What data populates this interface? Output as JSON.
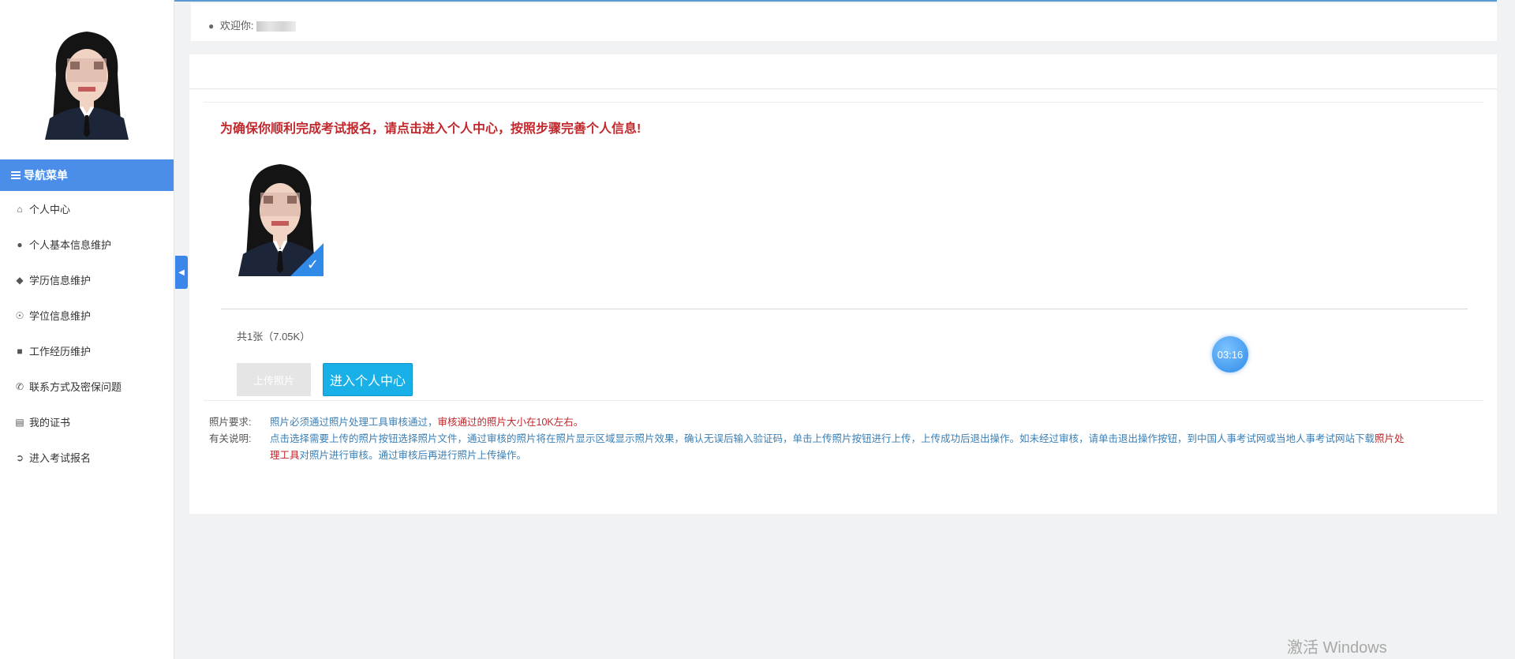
{
  "header": {
    "welcome_label": "欢迎你:",
    "user_name": ""
  },
  "sidebar": {
    "nav_title": "导航菜单",
    "items": [
      {
        "label": "个人中心",
        "icon": "home-icon"
      },
      {
        "label": "个人基本信息维护",
        "icon": "user-icon"
      },
      {
        "label": "学历信息维护",
        "icon": "graduation-cap-icon"
      },
      {
        "label": "学位信息维护",
        "icon": "medal-icon"
      },
      {
        "label": "工作经历维护",
        "icon": "briefcase-icon"
      },
      {
        "label": "联系方式及密保问题",
        "icon": "phone-icon"
      },
      {
        "label": "我的证书",
        "icon": "book-icon"
      },
      {
        "label": "进入考试报名",
        "icon": "arrow-circle-icon"
      }
    ]
  },
  "main": {
    "notice": "为确保你顺利完成考试报名，请点击进入个人中心，按照步骤完善个人信息!",
    "photo_count": "共1张（7.05K）",
    "upload_button": "上传照片",
    "enter_button": "进入个人中心",
    "requirement_label": "照片要求:",
    "requirement_text": "照片必须通过照片处理工具审核通过，",
    "requirement_red": "审核通过的照片大小在10K左右。",
    "instructions_label": "有关说明:",
    "instructions_text_1": "点击选择需要上传的照片按钮选择照片文件，通过审核的照片将在照片显示区域显示照片效果，确认无误后输入验证码，单击上传照片按钮进行上传，上传成功后退出操作。如未经过审核，请单击退出操作按钮，到中国人事考试网或当地人事考试网站下载",
    "instructions_red": "照片处理工具",
    "instructions_text_2": "对照片进行审核。通过审核后再进行照片上传操作。"
  },
  "timer": "03:16",
  "watermark": "激活 Windows",
  "colors": {
    "accent": "#4a8eea",
    "notice_red": "#c0282d",
    "enter_button": "#19b0e8",
    "info_text": "#3b7fb5"
  }
}
